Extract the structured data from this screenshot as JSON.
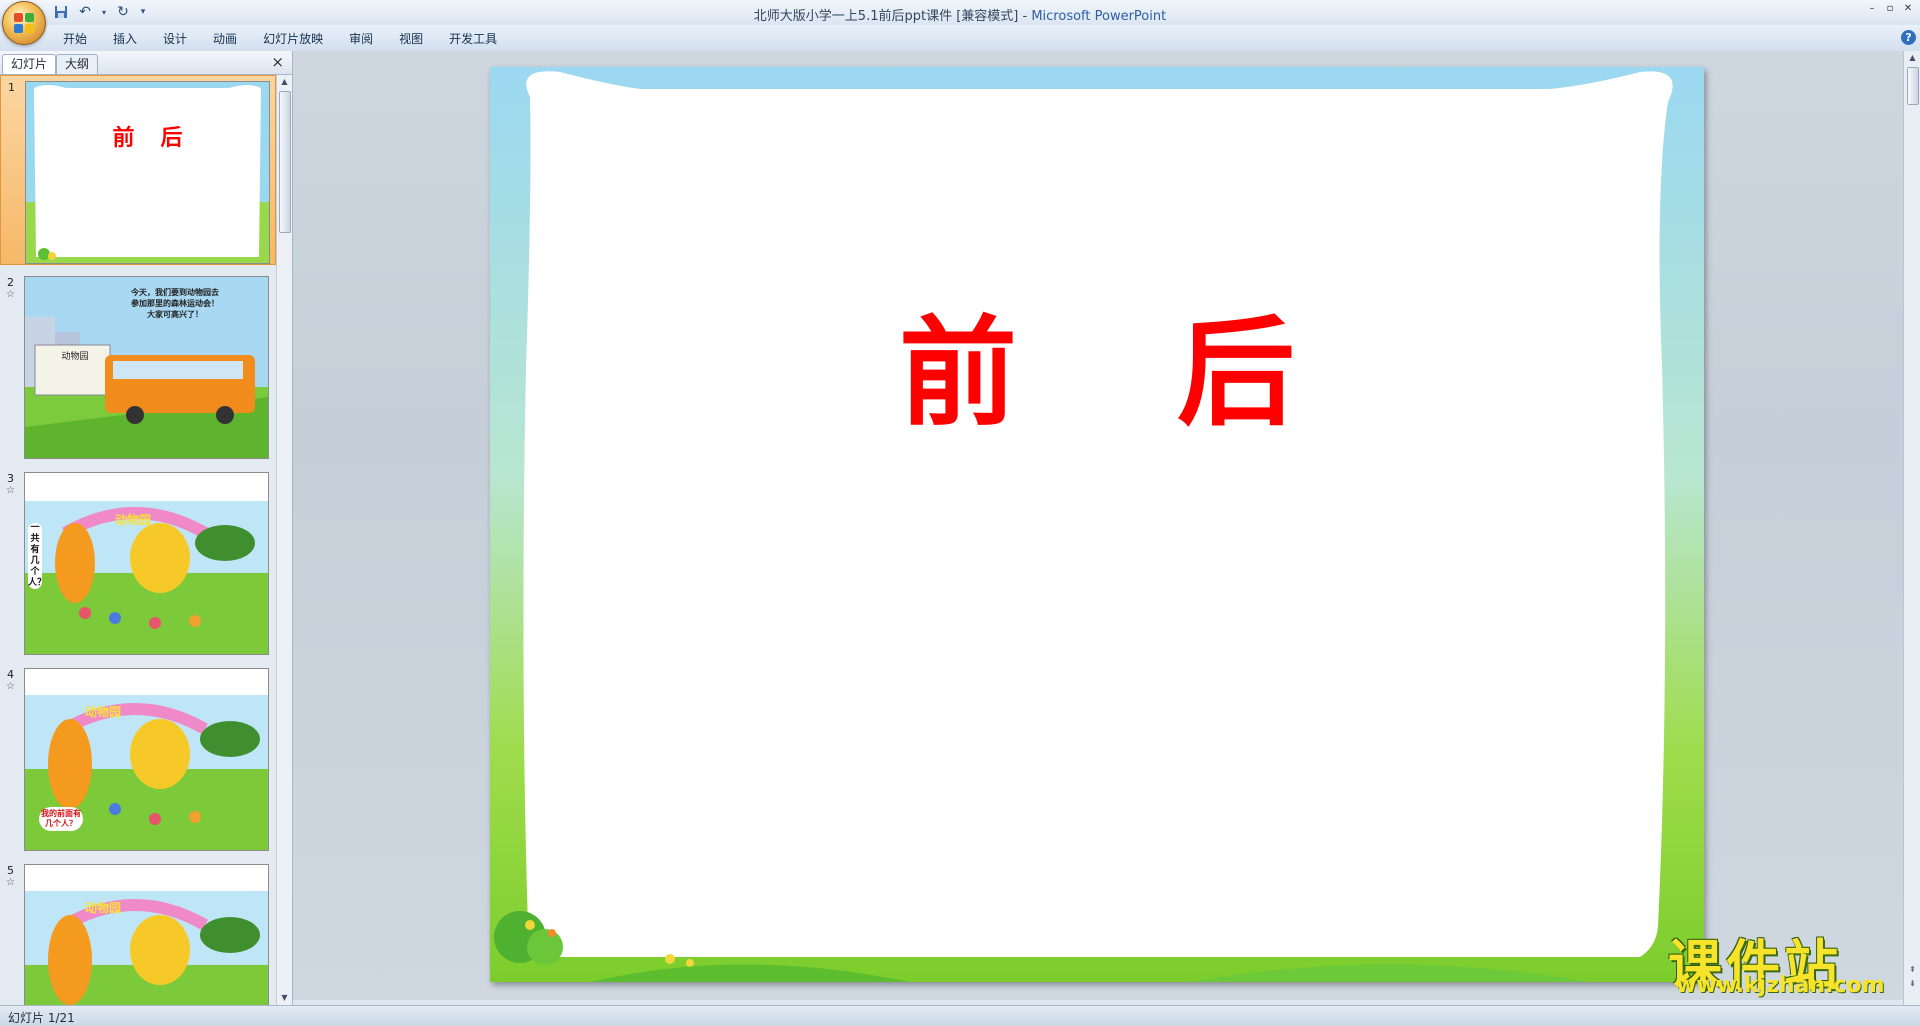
{
  "window": {
    "title": "北师大版小学一上5.1前后ppt课件 [兼容模式]",
    "title_sep": " - ",
    "app_name": "Microsoft PowerPoint"
  },
  "quick_access": {
    "icons": [
      "save-icon",
      "undo-icon",
      "redo-icon",
      "customize-icon"
    ]
  },
  "ribbon": {
    "tabs": [
      "开始",
      "插入",
      "设计",
      "动画",
      "幻灯片放映",
      "审阅",
      "视图",
      "开发工具"
    ]
  },
  "left_pane": {
    "tabs": [
      "幻灯片",
      "大纲"
    ],
    "close_glyph": "×",
    "thumbnails": [
      {
        "number": "1",
        "title": "前后",
        "selected": true
      },
      {
        "number": "2",
        "text": [
          "今天，我们要到动物园去",
          "参加那里的森林运动会！",
          "大家可高兴了！"
        ],
        "sign": "动物园"
      },
      {
        "number": "3",
        "arch": "动物园",
        "side_text": "一共有几个人？"
      },
      {
        "number": "4",
        "arch": "动物园",
        "bubble": "我的前面有几个人？"
      },
      {
        "number": "5",
        "arch": "动物园"
      }
    ]
  },
  "slide": {
    "title": "前后"
  },
  "status": {
    "text": "幻灯片 1/21"
  },
  "watermark": {
    "title": "课件站",
    "url": "www.kjzhan.com"
  },
  "colors": {
    "title_red": "#ff0000",
    "selected_thumb": "#f6b868",
    "frame_blue": "#8fd3f0",
    "frame_green": "#8cd23c"
  }
}
